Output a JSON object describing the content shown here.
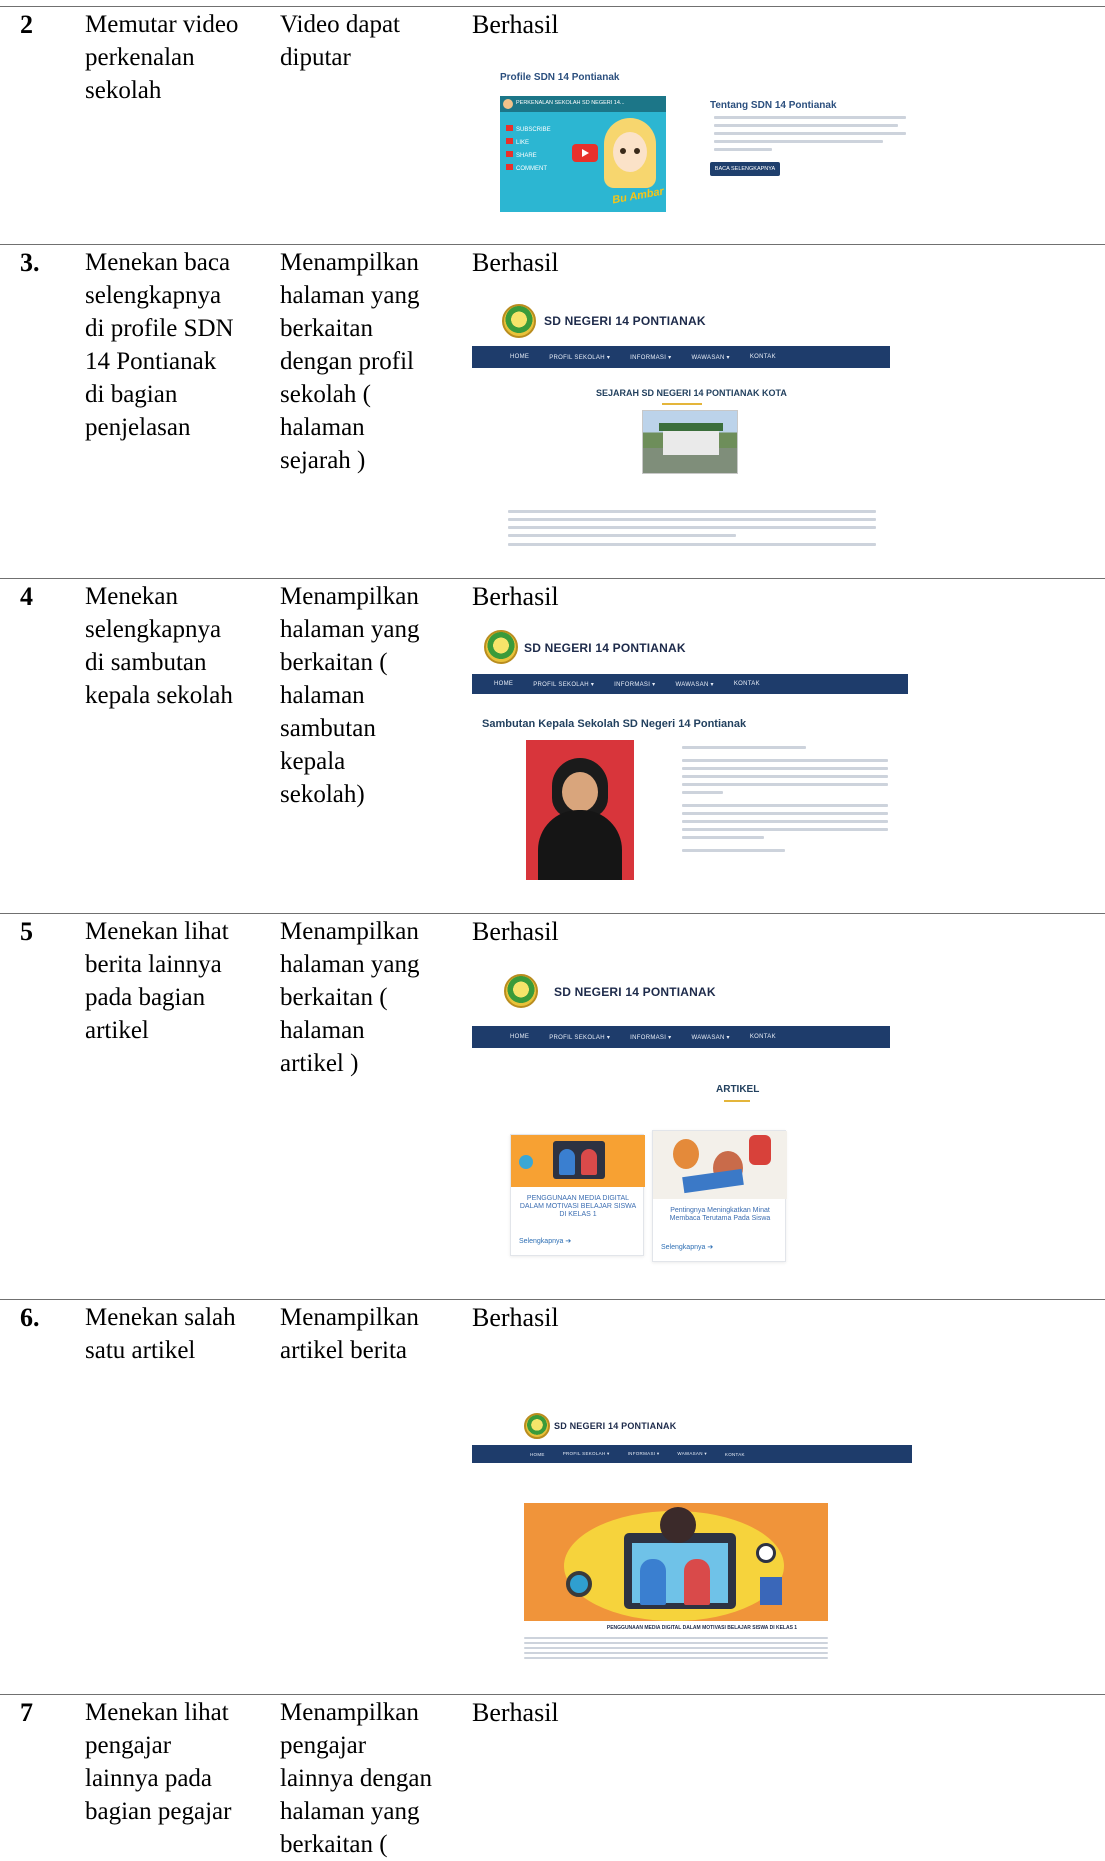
{
  "rows": [
    {
      "no": "2",
      "action": [
        "Memutar video",
        "perkenalan",
        "sekolah"
      ],
      "expected": [
        "Video dapat",
        "diputar"
      ],
      "result": "Berhasil"
    },
    {
      "no": "3.",
      "action": [
        "Menekan baca",
        "selengkapnya",
        "di profile SDN",
        "14 Pontianak",
        "di bagian",
        "penjelasan"
      ],
      "expected": [
        "Menampilkan",
        "halaman yang",
        "berkaitan",
        "dengan profil",
        "sekolah (",
        "halaman",
        "sejarah )"
      ],
      "result": "Berhasil"
    },
    {
      "no": "4",
      "action": [
        "Menekan",
        "selengkapnya",
        "di sambutan",
        "kepala sekolah"
      ],
      "expected": [
        "Menampilkan",
        "halaman yang",
        "berkaitan (",
        "halaman",
        "sambutan",
        "kepala",
        "sekolah)"
      ],
      "result": "Berhasil"
    },
    {
      "no": "5",
      "action": [
        "Menekan lihat",
        "berita lainnya",
        "pada bagian",
        "artikel"
      ],
      "expected": [
        "Menampilkan",
        "halaman yang",
        "berkaitan (",
        "halaman",
        "artikel )"
      ],
      "result": "Berhasil"
    },
    {
      "no": "6.",
      "action": [
        "Menekan salah",
        "satu artikel"
      ],
      "expected": [
        "Menampilkan",
        "artikel berita"
      ],
      "result": "Berhasil"
    },
    {
      "no": "7",
      "action": [
        "Menekan lihat",
        "pengajar",
        "lainnya pada",
        "bagian pegajar"
      ],
      "expected": [
        "Menampilkan",
        "pengajar",
        "lainnya dengan",
        "halaman yang",
        "berkaitan ("
      ],
      "result": "Berhasil"
    }
  ],
  "shots": {
    "profile": {
      "title": "Profile SDN 14 Pontianak",
      "video_title": "PERKENALAN SEKOLAH SD NEGERI 14...",
      "video_menu": [
        "SUBSCRIBE",
        "LIKE",
        "SHARE",
        "COMMENT"
      ],
      "video_sign": "Bu Ambar",
      "about_title": "Tentang SDN 14 Pontianak",
      "button": "BACA SELENGKAPNYA"
    },
    "site_name": "SD NEGERI 14 PONTIANAK",
    "nav": [
      "HOME",
      "PROFIL SEKOLAH ▾",
      "INFORMASI ▾",
      "WAWASAN ▾",
      "KONTAK"
    ],
    "sejarah_heading": "SEJARAH SD NEGERI 14 PONTIANAK KOTA",
    "sambutan_heading": "Sambutan Kepala Sekolah SD Negeri 14 Pontianak",
    "artikel_heading": "ARTIKEL",
    "articles": [
      {
        "title": "PENGGUNAAN MEDIA DIGITAL DALAM MOTIVASI BELAJAR SISWA DI KELAS 1",
        "link": "Selengkapnya ➔"
      },
      {
        "title": "Pentingnya Meningkatkan Minat Membaca Terutama Pada Siswa",
        "link": "Selengkapnya ➔"
      }
    ],
    "article_detail_title": "PENGGUNAAN MEDIA DIGITAL DALAM MOTIVASI BELAJAR SISWA DI KELAS 1"
  }
}
